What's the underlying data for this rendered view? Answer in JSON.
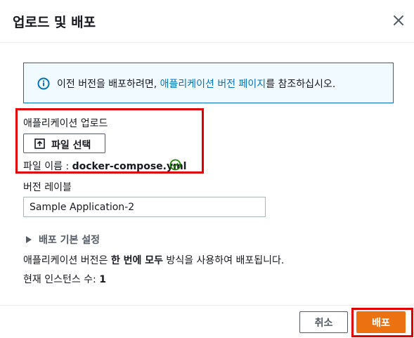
{
  "dialog": {
    "title": "업로드 및 배포",
    "close_icon": "close-icon"
  },
  "info": {
    "icon": "info-icon",
    "text_before": "이전 버전을 배포하려면, ",
    "link": "애플리케이션 버전 페이지",
    "text_after": "를 참조하십시오."
  },
  "upload": {
    "label": "애플리케이션 업로드",
    "button_icon": "upload-icon",
    "button_label": "파일 선택",
    "filename_label": "파일 이름 : ",
    "filename": "docker-compose.yml",
    "status_icon": "check-circle-icon"
  },
  "version": {
    "label": "버전 레이블",
    "value": "Sample Application-2"
  },
  "expander": {
    "label": "배포 기본 설정"
  },
  "summary": {
    "deploy_prefix": "애플리케이션 버전은 ",
    "deploy_bold": "한 번에 모두",
    "deploy_suffix": " 방식을 사용하여 배포됩니다.",
    "instances_label": "현재 인스턴스 수: ",
    "instances_count": "1"
  },
  "footer": {
    "cancel_label": "취소",
    "deploy_label": "배포"
  },
  "colors": {
    "accent": "#ec7211",
    "link": "#0073bb",
    "highlight": "#e00000",
    "success": "#1d8102"
  }
}
